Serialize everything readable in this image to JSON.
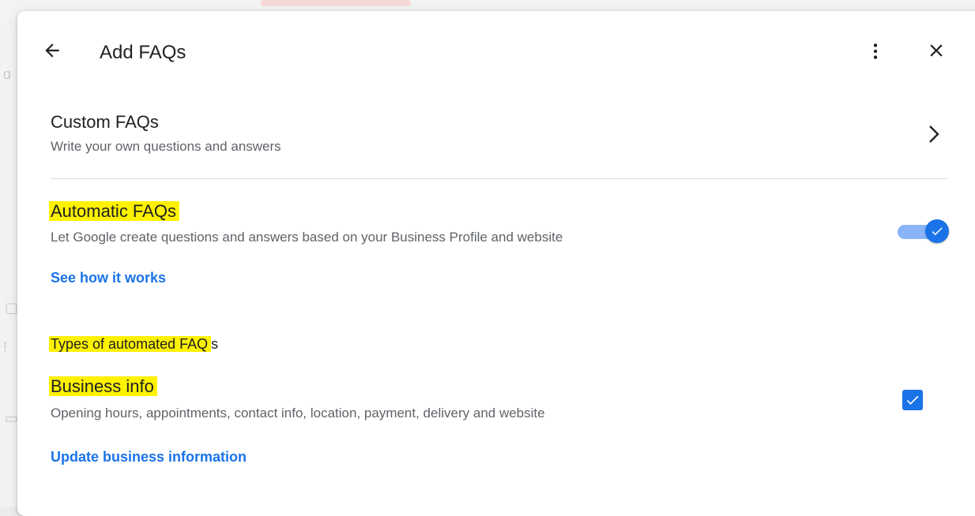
{
  "dialog": {
    "title": "Add FAQs"
  },
  "icons": {
    "back": "arrow-left-icon",
    "more": "more-vert-icon",
    "close": "close-icon",
    "chevron": "chevron-right-icon"
  },
  "custom_faqs": {
    "title": "Custom FAQs",
    "subtitle": "Write your own questions and answers"
  },
  "automatic_faqs": {
    "title": "Automatic FAQs",
    "subtitle": "Let Google create questions and answers based on your Business Profile and website",
    "link": "See how it works",
    "enabled": true
  },
  "types_section": {
    "heading_highlighted": "Types of automated FAQ",
    "heading_rest": "s"
  },
  "business_info": {
    "title": "Business info",
    "subtitle": "Opening hours, appointments, contact info, location, payment, delivery and website",
    "link": "Update business information",
    "checked": true
  },
  "colors": {
    "accent": "#1a73e8",
    "highlight": "#fff200",
    "toggle_track": "#8ab4f8",
    "divider": "#dadce0"
  }
}
